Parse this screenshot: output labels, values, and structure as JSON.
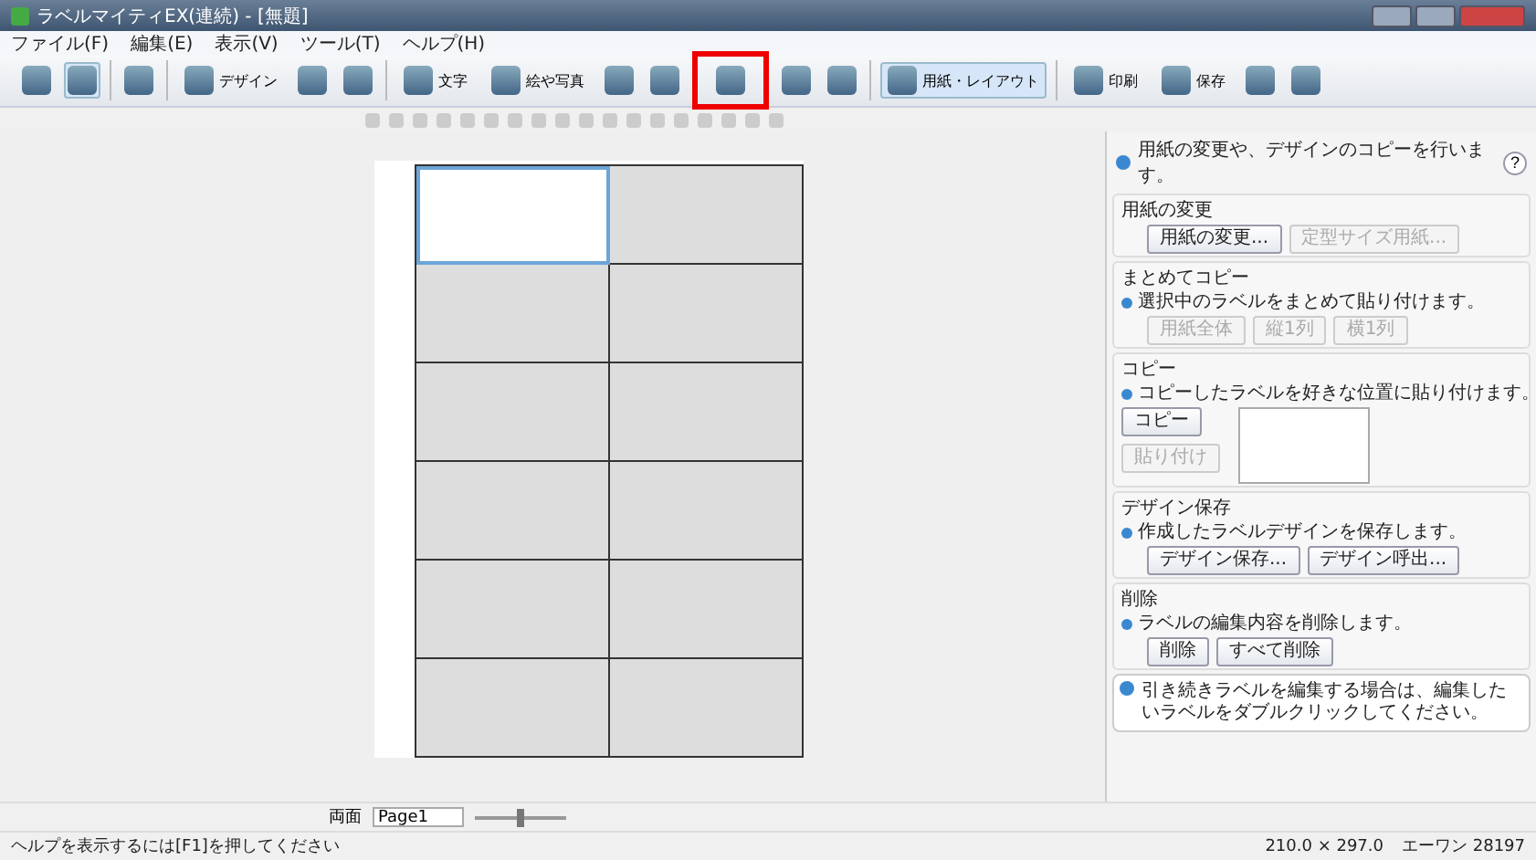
{
  "window": {
    "title": "ラベルマイティEX(連続) - [無題]"
  },
  "menu": [
    "ファイル(F)",
    "編集(E)",
    "表示(V)",
    "ツール(T)",
    "ヘルプ(H)"
  ],
  "toolbar": [
    {
      "kind": "icon"
    },
    {
      "kind": "icon",
      "selected": true
    },
    {
      "kind": "sep"
    },
    {
      "kind": "icon"
    },
    {
      "kind": "sep"
    },
    {
      "kind": "labeled",
      "label": "デザイン"
    },
    {
      "kind": "icon"
    },
    {
      "kind": "icon"
    },
    {
      "kind": "sep"
    },
    {
      "kind": "labeled",
      "label": "文字"
    },
    {
      "kind": "labeled",
      "label": "絵や写真"
    },
    {
      "kind": "icon"
    },
    {
      "kind": "icon"
    },
    {
      "kind": "icon",
      "highlighted": true
    },
    {
      "kind": "icon"
    },
    {
      "kind": "icon"
    },
    {
      "kind": "sep"
    },
    {
      "kind": "labeled",
      "label": "用紙・レイアウト",
      "selected": true
    },
    {
      "kind": "sep"
    },
    {
      "kind": "labeled",
      "label": "印刷"
    },
    {
      "kind": "labeled",
      "label": "保存"
    },
    {
      "kind": "icon"
    },
    {
      "kind": "icon"
    }
  ],
  "labels": [
    {
      "selected": true
    },
    {
      "selected": false
    },
    {
      "selected": false
    },
    {
      "selected": false
    },
    {
      "selected": false
    },
    {
      "selected": false
    },
    {
      "selected": false
    },
    {
      "selected": false
    },
    {
      "selected": false
    },
    {
      "selected": false
    },
    {
      "selected": false
    },
    {
      "selected": false
    }
  ],
  "panel": {
    "info": "用紙の変更や、デザインのコピーを行います。",
    "help": "?",
    "sections": [
      {
        "title": "用紙の変更",
        "buttons": [
          {
            "label": "用紙の変更...",
            "disabled": false
          },
          {
            "label": "定型サイズ用紙...",
            "disabled": true
          }
        ]
      },
      {
        "title": "まとめてコピー",
        "note": "選択中のラベルをまとめて貼り付けます。",
        "buttons": [
          {
            "label": "用紙全体",
            "disabled": true
          },
          {
            "label": "縦1列",
            "disabled": true
          },
          {
            "label": "横1列",
            "disabled": true
          }
        ]
      },
      {
        "title": "コピー",
        "note": "コピーしたラベルを好きな位置に貼り付けます。",
        "preview": true,
        "buttons": [
          {
            "label": "コピー",
            "disabled": false
          },
          {
            "label": "貼り付け",
            "disabled": true
          }
        ]
      },
      {
        "title": "デザイン保存",
        "note": "作成したラベルデザインを保存します。",
        "buttons": [
          {
            "label": "デザイン保存...",
            "disabled": false
          },
          {
            "label": "デザイン呼出...",
            "disabled": false
          }
        ]
      },
      {
        "title": "削除",
        "note": "ラベルの編集内容を削除します。",
        "buttons": [
          {
            "label": "削除",
            "disabled": false
          },
          {
            "label": "すべて削除",
            "disabled": false
          }
        ]
      }
    ],
    "hint": "引き続きラベルを編集する場合は、編集したいラベルをダブルクリックしてください。"
  },
  "bottom": {
    "duplex": "両面",
    "page": "Page1",
    "zoom": {
      "level": 0.5
    }
  },
  "status_bar": {
    "help": "ヘルプを表示するには[F1]を押してください",
    "size": "210.0 × 297.0",
    "paper": "エーワン 28197"
  }
}
